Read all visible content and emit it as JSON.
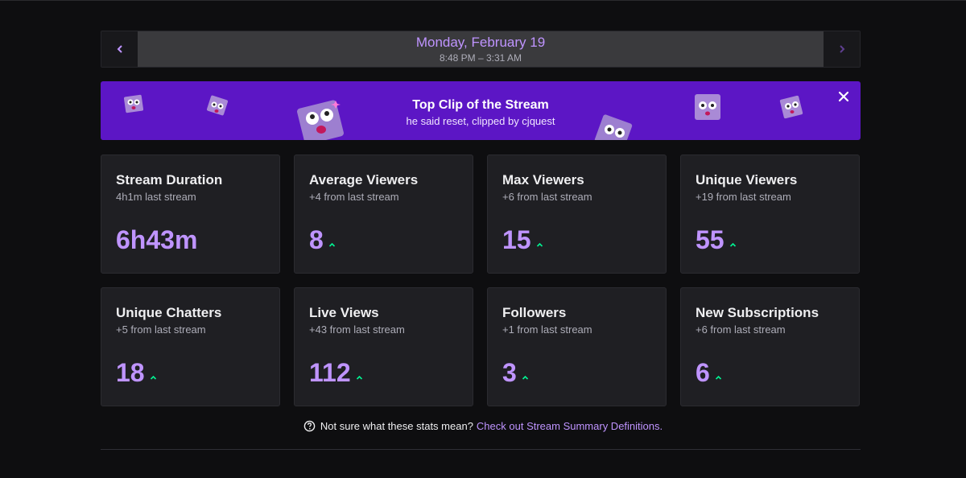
{
  "date_nav": {
    "title": "Monday, February 19",
    "time_range": "8:48 PM – 3:31 AM",
    "prev_icon": "chevron-left-icon",
    "next_icon": "chevron-right-icon"
  },
  "clip_banner": {
    "title": "Top Clip of the Stream",
    "subtitle": "he said reset, clipped by cjquest",
    "close_icon": "close-icon",
    "background": "#5c16c5"
  },
  "stats": [
    {
      "title": "Stream Duration",
      "sub": "4h1m last stream",
      "value": "6h43m",
      "trend": "none"
    },
    {
      "title": "Average Viewers",
      "sub": "+4 from last stream",
      "value": "8",
      "trend": "up"
    },
    {
      "title": "Max Viewers",
      "sub": "+6 from last stream",
      "value": "15",
      "trend": "up"
    },
    {
      "title": "Unique Viewers",
      "sub": "+19 from last stream",
      "value": "55",
      "trend": "up"
    },
    {
      "title": "Unique Chatters",
      "sub": "+5 from last stream",
      "value": "18",
      "trend": "up"
    },
    {
      "title": "Live Views",
      "sub": "+43 from last stream",
      "value": "112",
      "trend": "up"
    },
    {
      "title": "Followers",
      "sub": "+1 from last stream",
      "value": "3",
      "trend": "up"
    },
    {
      "title": "New Subscriptions",
      "sub": "+6 from last stream",
      "value": "6",
      "trend": "up"
    }
  ],
  "help": {
    "text": "Not sure what these stats mean?",
    "link": "Check out Stream Summary Definitions.",
    "icon": "question-circle-icon"
  },
  "colors": {
    "accent": "#bf94ff",
    "trend_up": "#00f593",
    "card_bg": "#1f1f23"
  }
}
